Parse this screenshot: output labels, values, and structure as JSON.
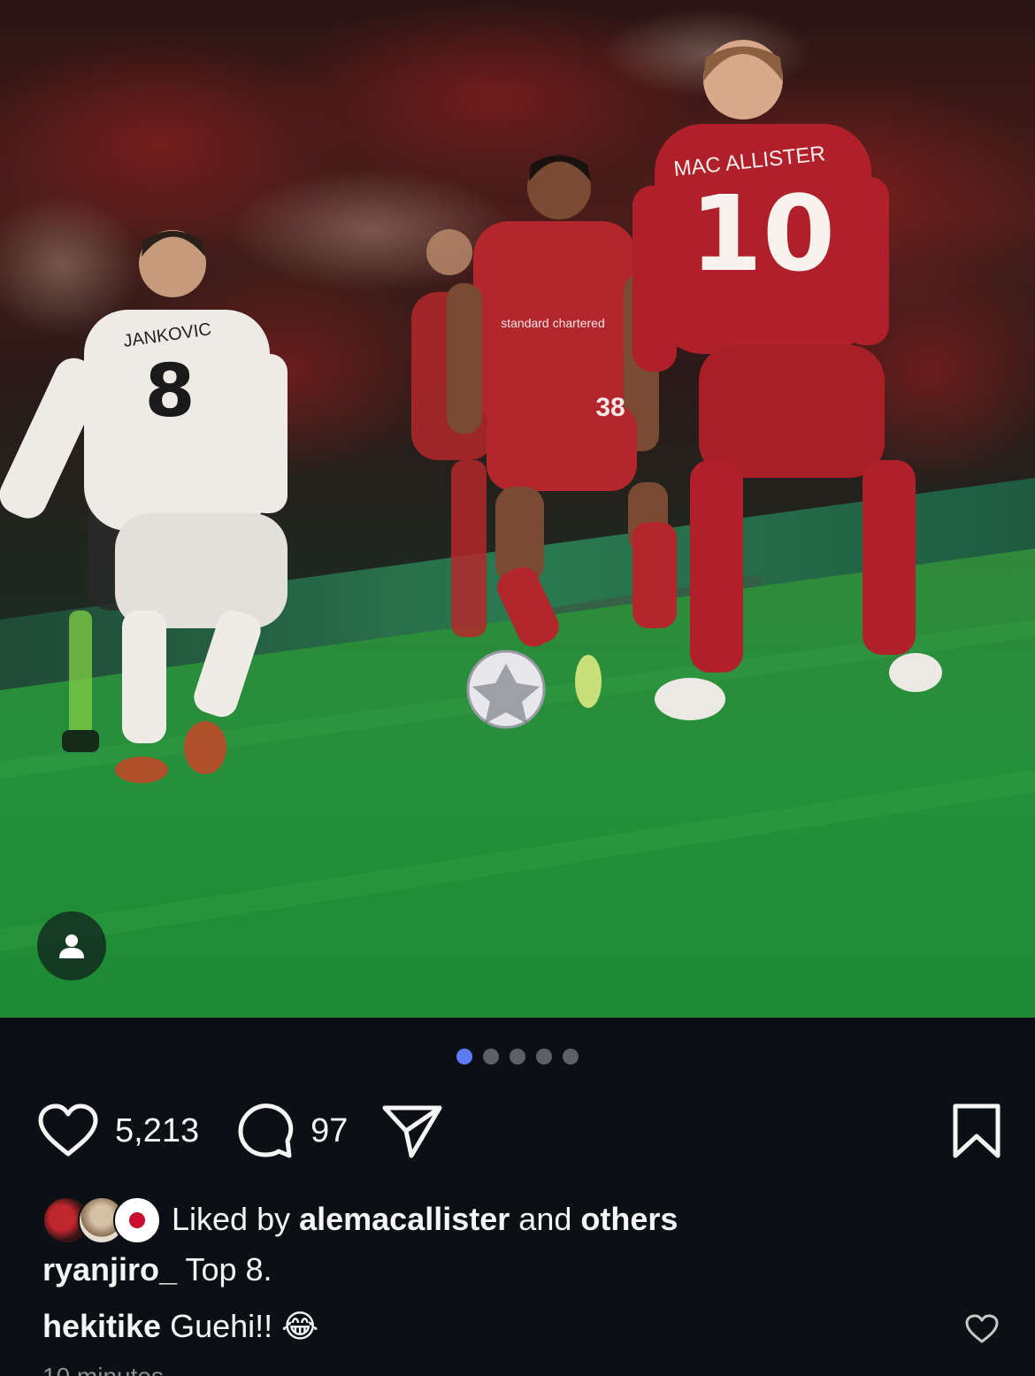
{
  "post": {
    "image_alt": "Football match photo",
    "carousel": {
      "total": 5,
      "active_index": 0
    },
    "actions": {
      "like_count": "5,213",
      "comment_count": "97"
    },
    "liked_by": {
      "prefix": "Liked by",
      "user": "alemacallister",
      "joiner": "and",
      "suffix": "others"
    },
    "caption": {
      "username": "ryanjiro_",
      "text": "Top 8."
    },
    "comments": [
      {
        "username": "hekitike",
        "text": "Guehi!! 😂"
      }
    ],
    "timestamp_fragment": "10 minutes"
  },
  "colors": {
    "background": "#0c1014",
    "active_dot": "#5b7cf6",
    "inactive_dot": "#5c6166",
    "text": "#f5f5f5",
    "muted": "#8e8e8e"
  }
}
